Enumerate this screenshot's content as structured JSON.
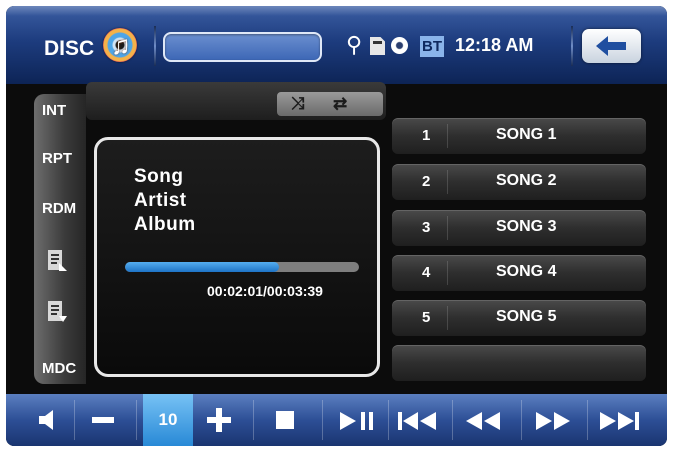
{
  "header": {
    "source_label": "DISC",
    "time": "12:18 AM",
    "bt_label": "BT",
    "icons": [
      "music-disc-icon",
      "usb-icon",
      "sd-card-icon",
      "dvd-icon",
      "back-arrow-icon"
    ]
  },
  "side_menu": {
    "items": [
      "INT",
      "RPT",
      "RDM",
      "MDC"
    ],
    "icons": [
      "list-play-icon",
      "list-down-icon"
    ]
  },
  "mode_icons": [
    "shuffle-icon",
    "repeat-icon"
  ],
  "now_playing": {
    "song": "Song",
    "artist": "Artist",
    "album": "Album",
    "time": "00:02:01/00:03:39",
    "progress": 0.66
  },
  "playlist": [
    {
      "num": "1",
      "name": "SONG 1"
    },
    {
      "num": "2",
      "name": "SONG 2"
    },
    {
      "num": "3",
      "name": "SONG 3"
    },
    {
      "num": "4",
      "name": "SONG 4"
    },
    {
      "num": "5",
      "name": "SONG 5"
    },
    {
      "num": "",
      "name": ""
    }
  ],
  "controls": {
    "volume": "10",
    "buttons": [
      "mute-icon",
      "volume-down-icon",
      "volume-up-icon",
      "stop-icon",
      "play-pause-icon",
      "previous-track-icon",
      "rewind-icon",
      "fast-forward-icon",
      "next-track-icon"
    ]
  },
  "colors": {
    "accent_blue": "#2d4f96",
    "progress_blue": "#2889d6",
    "background": "#0c0c0c"
  }
}
